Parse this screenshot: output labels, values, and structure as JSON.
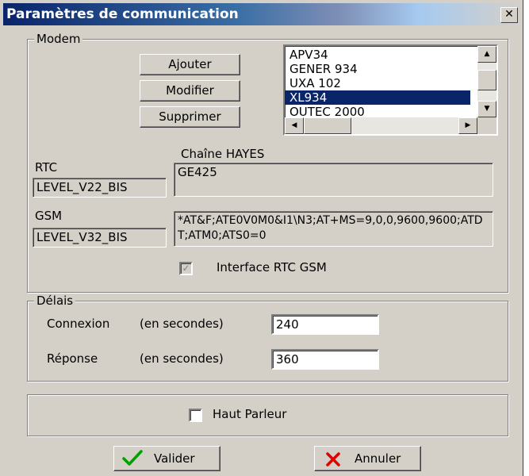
{
  "window": {
    "title": "Paramètres de communication",
    "close": "✕"
  },
  "modem": {
    "legend": "Modem",
    "buttons": {
      "add": "Ajouter",
      "modify": "Modifier",
      "delete": "Supprimer"
    },
    "list": [
      "APV34",
      "GENER 934",
      "UXA 102",
      "XL934",
      "OUTEC 2000"
    ],
    "selected_index": 3,
    "hayes_label": "Chaîne HAYES",
    "rtc": {
      "label": "RTC",
      "value": "LEVEL_V22_BIS",
      "hayes": "GE425"
    },
    "gsm": {
      "label": "GSM",
      "value": "LEVEL_V32_BIS",
      "hayes": "*AT&F;ATE0V0M0&I1\\N3;AT+MS=9,0,0,9600,9600;ATDT;ATM0;ATS0=0"
    },
    "interface": {
      "label": "Interface RTC GSM",
      "checked": true,
      "disabled": true
    }
  },
  "delays": {
    "legend": "Délais",
    "connexion": {
      "label": "Connexion",
      "unit": "(en secondes)",
      "value": "240"
    },
    "reponse": {
      "label": "Réponse",
      "unit": "(en secondes)",
      "value": "360"
    }
  },
  "speaker": {
    "label": "Haut Parleur",
    "checked": false
  },
  "actions": {
    "ok": "Valider",
    "cancel": "Annuler"
  },
  "colors": {
    "ok_check": "#00a000",
    "cancel_x": "#e00000",
    "selection": "#0a246a"
  }
}
